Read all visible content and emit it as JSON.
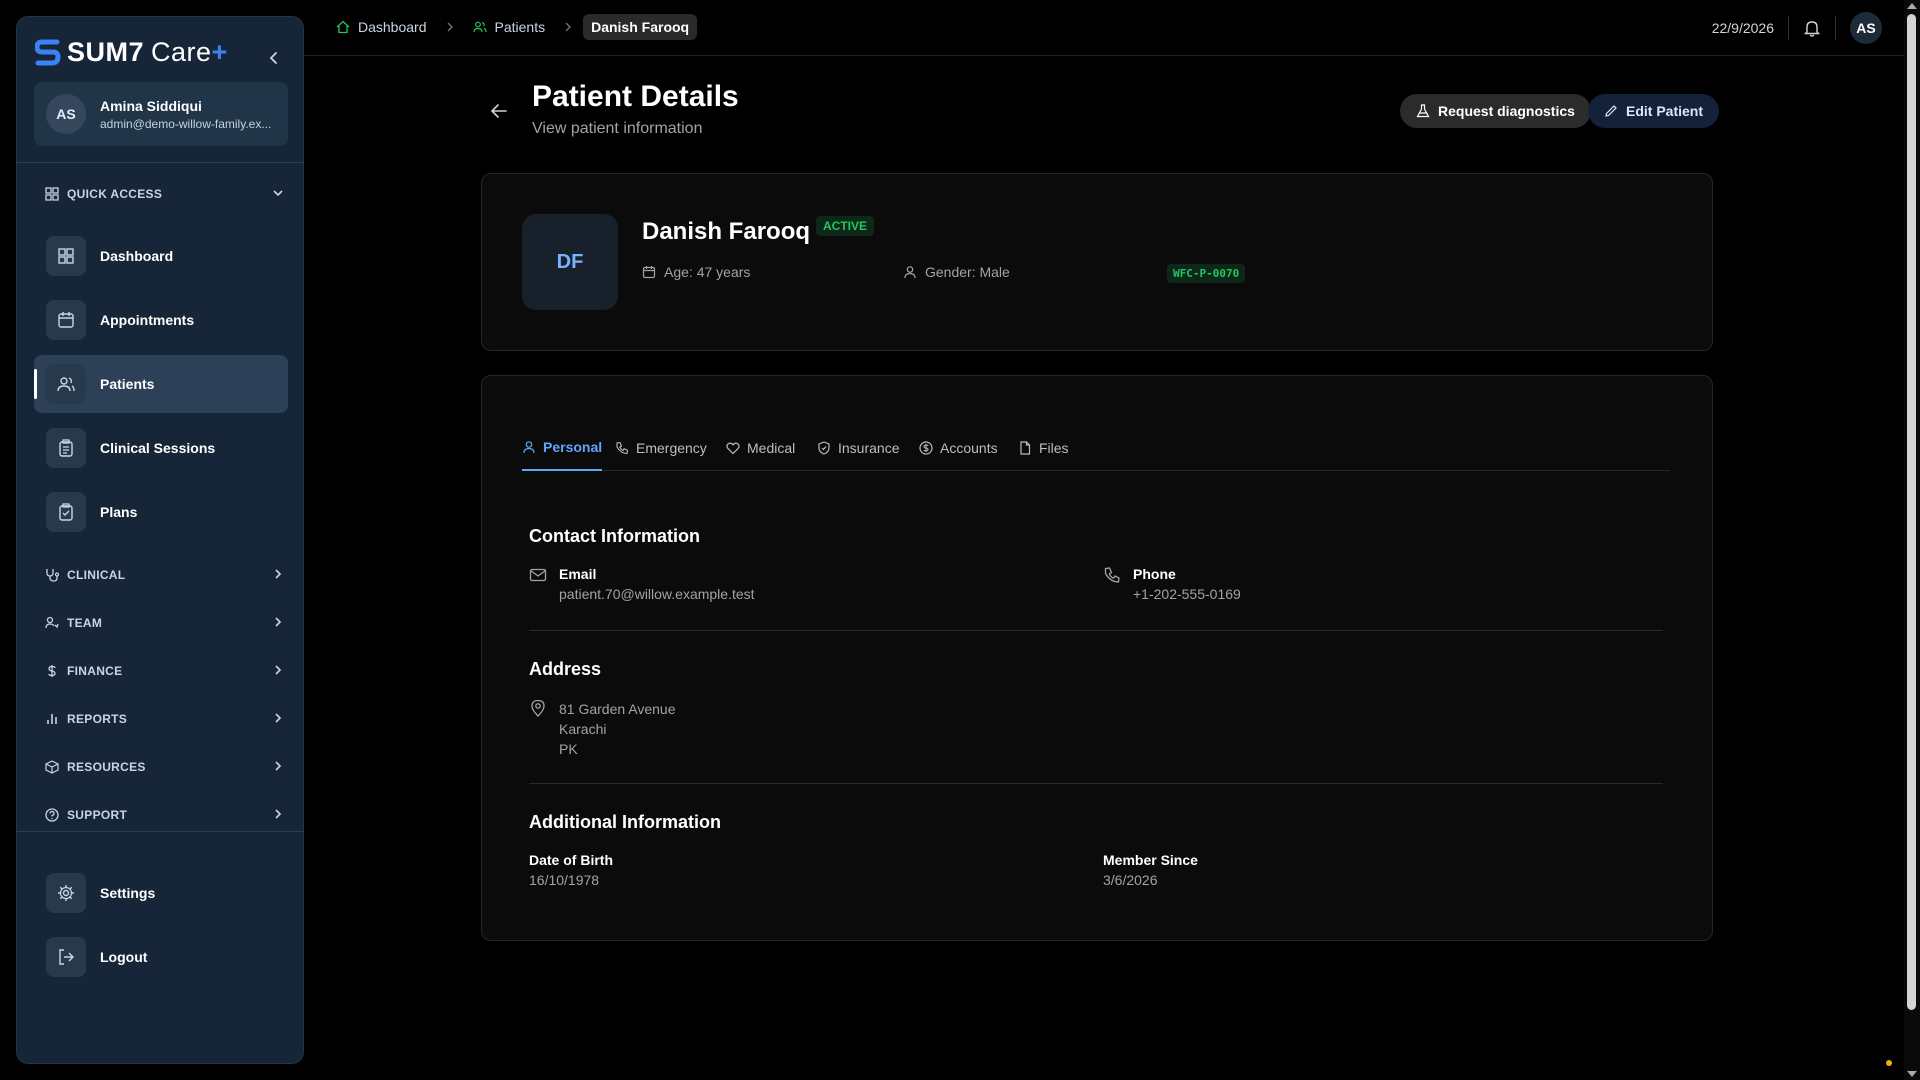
{
  "brand": {
    "name": "SUM7",
    "care": "Care",
    "plus": "+"
  },
  "user": {
    "initials": "AS",
    "name": "Amina Siddiqui",
    "email": "admin@demo-willow-family.ex..."
  },
  "sidebar": {
    "quick_access": "QUICK ACCESS",
    "items": [
      {
        "label": "Dashboard",
        "icon": "dashboard-icon"
      },
      {
        "label": "Appointments",
        "icon": "calendar-icon"
      },
      {
        "label": "Patients",
        "icon": "users-icon",
        "active": true
      },
      {
        "label": "Clinical Sessions",
        "icon": "clipboard-icon"
      },
      {
        "label": "Plans",
        "icon": "clipboard-check-icon"
      }
    ],
    "sections": [
      {
        "label": "CLINICAL",
        "icon": "stethoscope-icon"
      },
      {
        "label": "TEAM",
        "icon": "team-icon"
      },
      {
        "label": "FINANCE",
        "icon": "dollar-icon"
      },
      {
        "label": "REPORTS",
        "icon": "bar-chart-icon"
      },
      {
        "label": "RESOURCES",
        "icon": "package-icon"
      },
      {
        "label": "SUPPORT",
        "icon": "help-icon"
      }
    ],
    "settings": "Settings",
    "logout": "Logout"
  },
  "breadcrumb": {
    "items": [
      "Dashboard",
      "Patients",
      "Danish Farooq"
    ]
  },
  "topbar": {
    "date": "22/9/2026",
    "initials": "AS"
  },
  "header": {
    "title": "Patient Details",
    "subtitle": "View patient information",
    "request_diagnostics": "Request diagnostics",
    "edit_patient": "Edit Patient"
  },
  "patient": {
    "initials": "DF",
    "name": "Danish Farooq",
    "status": "ACTIVE",
    "age": "Age: 47 years",
    "gender": "Gender: Male",
    "code": "WFC-P-0070"
  },
  "tabs": [
    "Personal",
    "Emergency",
    "Medical",
    "Insurance",
    "Accounts",
    "Files"
  ],
  "contact": {
    "title": "Contact Information",
    "email_label": "Email",
    "email": "patient.70@willow.example.test",
    "phone_label": "Phone",
    "phone": "+1-202-555-0169"
  },
  "address": {
    "title": "Address",
    "lines": [
      "81 Garden Avenue",
      "Karachi",
      "PK"
    ]
  },
  "additional": {
    "title": "Additional Information",
    "dob_label": "Date of Birth",
    "dob": "16/10/1978",
    "member_label": "Member Since",
    "member_since": "3/6/2026"
  },
  "colors": {
    "accent": "#60a5fa",
    "active_badge": "#22c55e",
    "sidebar_bg": "#162638"
  }
}
